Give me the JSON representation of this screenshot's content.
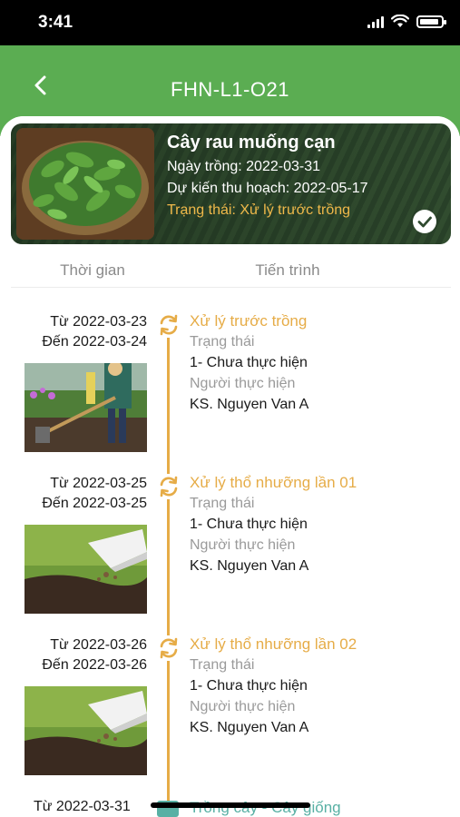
{
  "status_bar": {
    "time": "3:41"
  },
  "header": {
    "title": "FHN-L1-O21",
    "back_icon": "chevron-left-icon"
  },
  "plant": {
    "name": "Cây rau muống cạn",
    "planting_date": "Ngày trồng: 2022-03-31",
    "expected_harvest": "Dự kiến thu hoạch: 2022-05-17",
    "status": "Trạng thái: Xử lý trước trồng",
    "check_icon": "check-circle-icon"
  },
  "columns": {
    "time": "Thời gian",
    "progress": "Tiến trình"
  },
  "steps": [
    {
      "from": "Từ 2022-03-23",
      "to": "Đến 2022-03-24",
      "title": "Xử lý trước trồng",
      "status_label": "Trạng thái",
      "status_value": "1- Chưa thực hiện",
      "executor_label": "Người thực hiện",
      "executor_value": "KS. Nguyen Van A",
      "photo": "gardener-digging"
    },
    {
      "from": "Từ 2022-03-25",
      "to": "Đến 2022-03-25",
      "title": "Xử lý thổ nhưỡng lần 01",
      "status_label": "Trạng thái",
      "status_value": "1- Chưa thực hiện",
      "executor_label": "Người thực hiện",
      "executor_value": "KS. Nguyen Van A",
      "photo": "soil-fertilizer"
    },
    {
      "from": "Từ 2022-03-26",
      "to": "Đến 2022-03-26",
      "title": "Xử lý thổ nhưỡng lần 02",
      "status_label": "Trạng thái",
      "status_value": "1- Chưa thực hiện",
      "executor_label": "Người thực hiện",
      "executor_value": "KS. Nguyen Van A",
      "photo": "soil-fertilizer"
    }
  ],
  "last_step": {
    "from": "Từ 2022-03-31",
    "title": "Trồng cây - Cây giống"
  },
  "colors": {
    "header_green": "#5bad52",
    "accent_orange": "#e6ac47",
    "teal": "#58b0a4"
  }
}
